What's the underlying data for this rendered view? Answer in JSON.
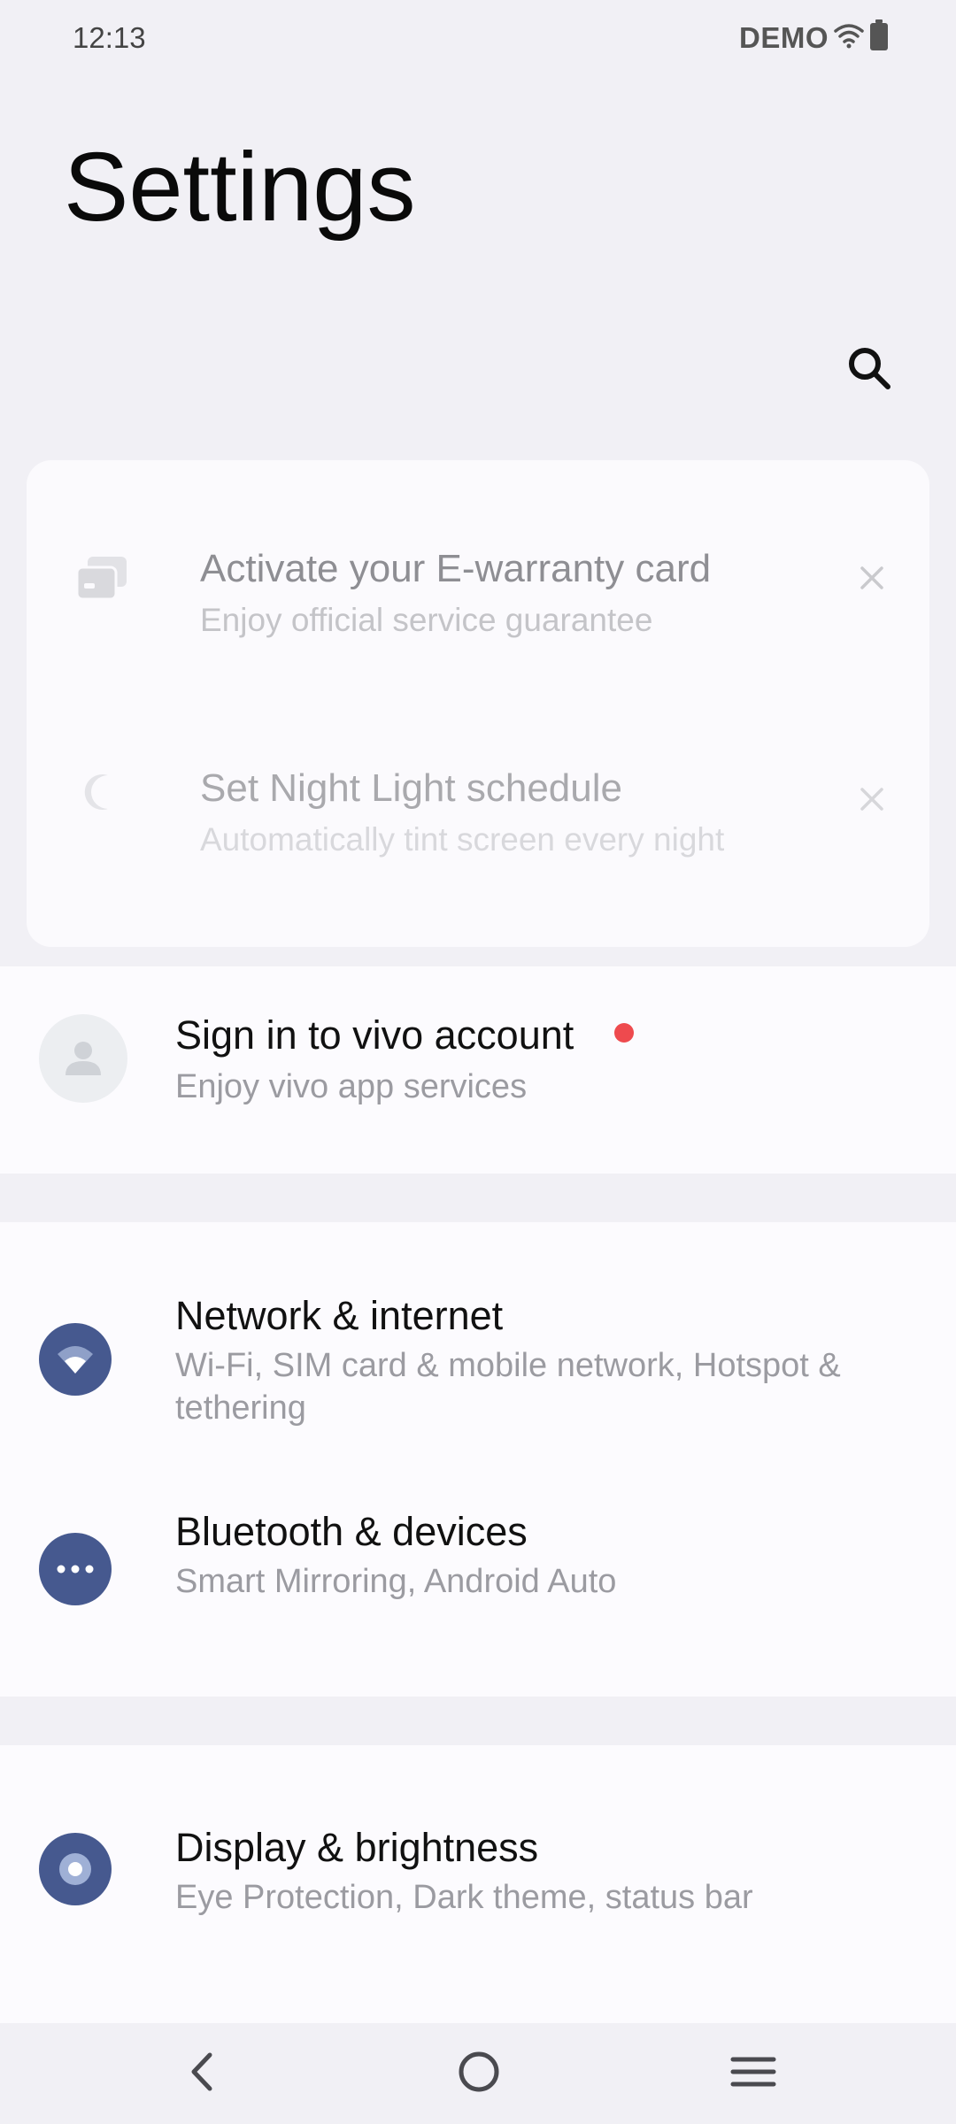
{
  "status_bar": {
    "time": "12:13",
    "carrier": "DEMO",
    "wifi_icon": "wifi-icon",
    "battery_icon": "battery-icon"
  },
  "header": {
    "title": "Settings",
    "search_icon": "search-icon"
  },
  "suggestions": [
    {
      "title": "Activate your E-warranty card",
      "subtitle": "Enjoy official service guarantee",
      "icon": "card-icon"
    },
    {
      "title": "Set Night Light schedule",
      "subtitle": "Automatically tint screen every night",
      "icon": "moon-icon"
    }
  ],
  "account": {
    "title": "Sign in to vivo account",
    "subtitle": "Enjoy vivo app services",
    "badge_color": "#ee4a4e"
  },
  "settings": [
    {
      "title": "Network & internet",
      "subtitle": "Wi-Fi, SIM card & mobile network, Hotspot & tethering",
      "icon": "wifi-icon"
    },
    {
      "title": "Bluetooth & devices",
      "subtitle": "Smart Mirroring, Android Auto",
      "icon": "more-dots-icon"
    },
    {
      "title": "Display & brightness",
      "subtitle": "Eye Protection, Dark theme, status bar",
      "icon": "brightness-icon"
    }
  ],
  "colors": {
    "accent": "#46598f",
    "background": "#f1f0f5",
    "card": "#fcfbfe"
  },
  "nav_bar": {
    "back_icon": "back-icon",
    "home_icon": "home-icon",
    "menu_icon": "menu-icon"
  }
}
